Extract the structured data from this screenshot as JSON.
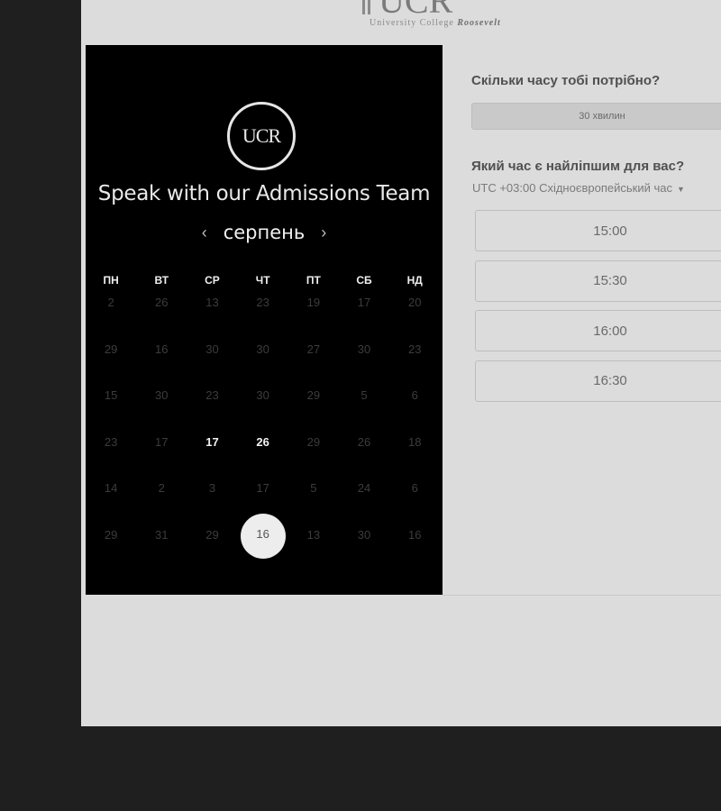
{
  "header": {
    "logo_text": "UCR",
    "logo_subtitle_prefix": "University College",
    "logo_subtitle_emph": "Roosevelt"
  },
  "calendar": {
    "badge_text": "UCR",
    "title": "Speak with our Admissions Team",
    "month": "серпень",
    "prev_icon": "chevron-left",
    "next_icon": "chevron-right",
    "weekdays": [
      "ПН",
      "ВТ",
      "СР",
      "ЧТ",
      "ПТ",
      "СБ",
      "НД"
    ],
    "weeks": [
      [
        {
          "d": "2"
        },
        {
          "d": "26"
        },
        {
          "d": "13"
        },
        {
          "d": "23"
        },
        {
          "d": "19"
        },
        {
          "d": "17"
        },
        {
          "d": "20"
        }
      ],
      [
        {
          "d": "29"
        },
        {
          "d": "16"
        },
        {
          "d": "30"
        },
        {
          "d": "30"
        },
        {
          "d": "27"
        },
        {
          "d": "30"
        },
        {
          "d": "23"
        }
      ],
      [
        {
          "d": "15"
        },
        {
          "d": "30"
        },
        {
          "d": "23"
        },
        {
          "d": "30"
        },
        {
          "d": "29"
        },
        {
          "d": "5"
        },
        {
          "d": "6"
        }
      ],
      [
        {
          "d": "23"
        },
        {
          "d": "17"
        },
        {
          "d": "17",
          "avail": true
        },
        {
          "d": "26",
          "avail": true
        },
        {
          "d": "29"
        },
        {
          "d": "26"
        },
        {
          "d": "18"
        }
      ],
      [
        {
          "d": "14"
        },
        {
          "d": "2"
        },
        {
          "d": "3"
        },
        {
          "d": "17"
        },
        {
          "d": "5"
        },
        {
          "d": "24"
        },
        {
          "d": "6"
        }
      ],
      [
        {
          "d": "29"
        },
        {
          "d": "31"
        },
        {
          "d": "29"
        },
        {
          "d": "16",
          "selected": true
        },
        {
          "d": "13"
        },
        {
          "d": "30"
        },
        {
          "d": "16"
        }
      ]
    ]
  },
  "booking": {
    "duration_question": "Скільки часу тобі потрібно?",
    "duration_value": "30 хвилин",
    "time_question": "Який час є найліпшим для вас?",
    "timezone": "UTC +03:00 Східноєвропейський час",
    "timezone_caret_icon": "caret-down",
    "slots": [
      "15:00",
      "15:30",
      "16:00",
      "16:30"
    ]
  },
  "colors": {
    "panel_bg": "#000000",
    "page_bg": "#dcdcdc",
    "outer_bg": "#1f1f1f"
  }
}
